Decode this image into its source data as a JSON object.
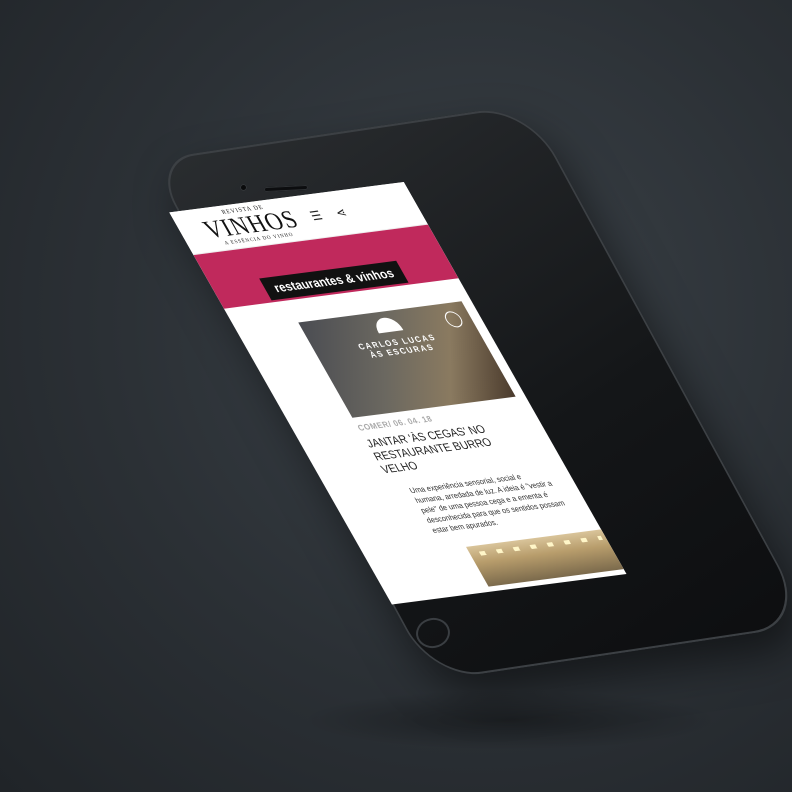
{
  "header": {
    "logo_small": "REVISTA DE",
    "logo_main": "VINHOS",
    "logo_sub": "A ESSÊNCIA DO VINHO",
    "menu_icon": "hamburger-icon",
    "share_icon": "share-icon"
  },
  "section": {
    "label": "restaurantes & vinhos",
    "banner_color": "#c0295c"
  },
  "article": {
    "hero": {
      "line1": "CARLOS LUCAS",
      "line2": "ÀS ESCURAS"
    },
    "meta": "COMER/ 06. 04. 18",
    "title": "JANTAR 'ÀS CEGAS' NO RESTAURANTE BURRO VELHO",
    "excerpt": "Uma experiência sensorial, social e humana, arredada de luz. A ideia é \"vestir a pele\" de uma pessoa cega e a ementa é desconhecida para que os sentidos possam estar bem apurados."
  }
}
